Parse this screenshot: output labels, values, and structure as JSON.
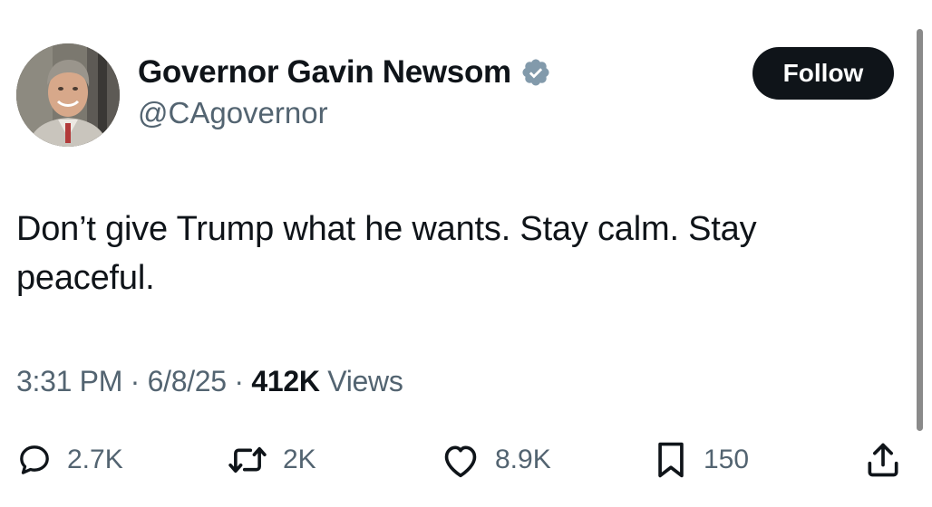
{
  "author": {
    "display_name": "Governor Gavin Newsom",
    "handle": "@CAgovernor",
    "verified_badge": "verified-badge-icon",
    "avatar": "avatar-photo"
  },
  "follow_button": {
    "label": "Follow"
  },
  "tweet": {
    "text": "Don’t give Trump what he wants. Stay calm. Stay peaceful."
  },
  "meta": {
    "time": "3:31 PM",
    "sep1": " · ",
    "date": "6/8/25",
    "sep2": " · ",
    "views_count": "412K",
    "views_label": " Views"
  },
  "actions": {
    "reply": {
      "icon": "reply-icon",
      "count": "2.7K"
    },
    "retweet": {
      "icon": "retweet-icon",
      "count": "2K"
    },
    "like": {
      "icon": "heart-icon",
      "count": "8.9K"
    },
    "bookmark": {
      "icon": "bookmark-icon",
      "count": "150"
    },
    "share": {
      "icon": "share-icon"
    }
  },
  "colors": {
    "text_primary": "#0f1419",
    "text_secondary": "#536471",
    "verified_gray": "#829aab",
    "button_bg": "#0f1419",
    "button_text": "#ffffff"
  }
}
